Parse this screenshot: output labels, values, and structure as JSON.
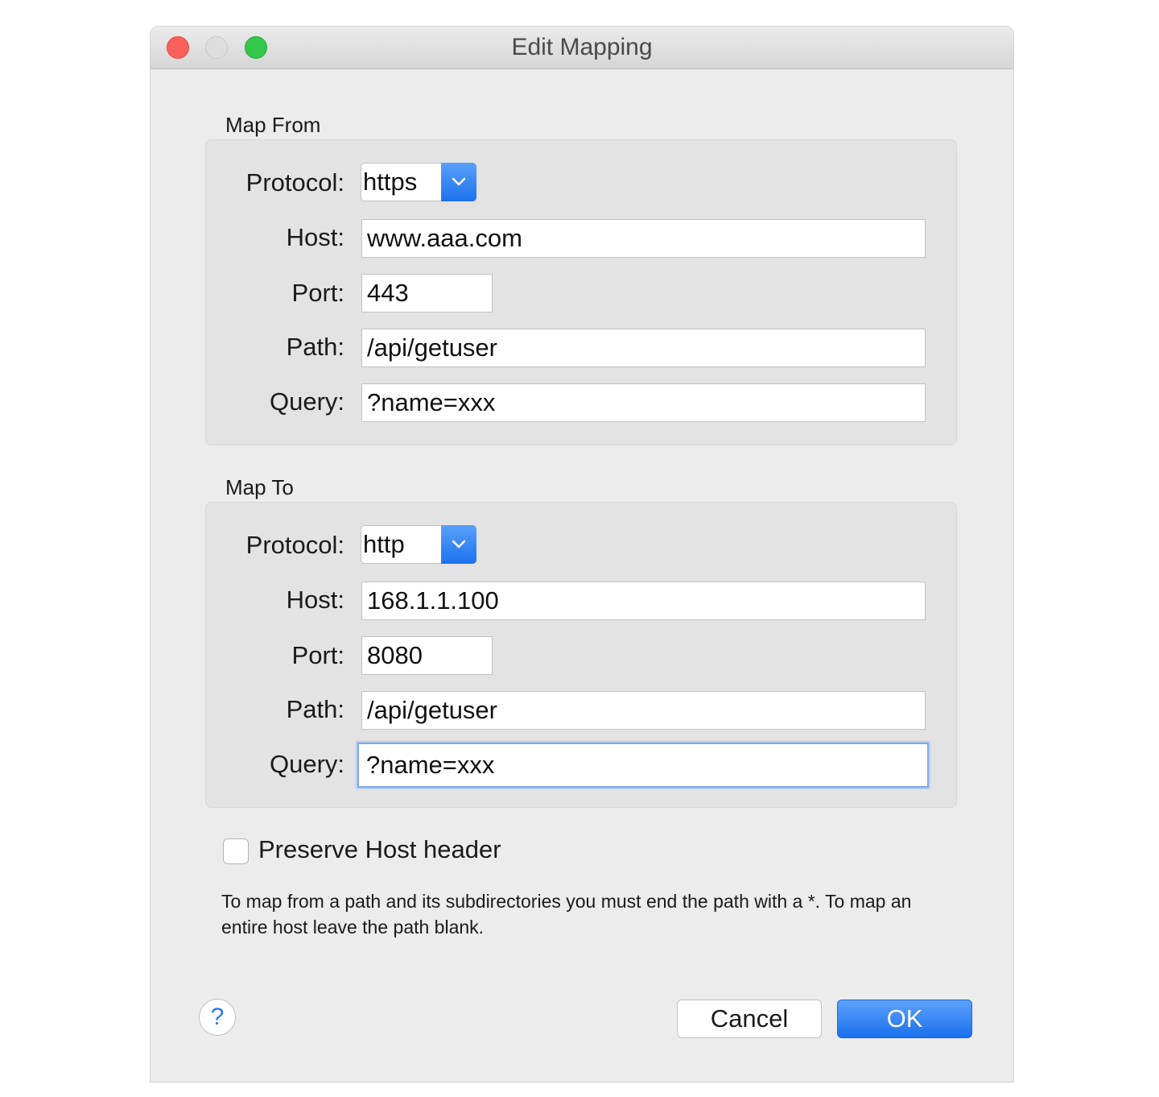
{
  "window": {
    "title": "Edit Mapping"
  },
  "map_from": {
    "label": "Map From",
    "protocol_label": "Protocol:",
    "protocol": "https",
    "host_label": "Host:",
    "host": "www.aaa.com",
    "port_label": "Port:",
    "port": "443",
    "path_label": "Path:",
    "path": "/api/getuser",
    "query_label": "Query:",
    "query": "?name=xxx"
  },
  "map_to": {
    "label": "Map To",
    "protocol_label": "Protocol:",
    "protocol": "http",
    "host_label": "Host:",
    "host": "168.1.1.100",
    "port_label": "Port:",
    "port": "8080",
    "path_label": "Path:",
    "path": "/api/getuser",
    "query_label": "Query:",
    "query": "?name=xxx"
  },
  "options": {
    "preserve_host_label": "Preserve Host header",
    "preserve_host_checked": false
  },
  "hint": "To map from a path and its subdirectories you must end the path with a *. To map an entire host leave the path blank.",
  "buttons": {
    "help": "?",
    "cancel": "Cancel",
    "ok": "OK"
  },
  "icons": {
    "dropdown": "chevron-down-icon",
    "help": "question-icon"
  },
  "colors": {
    "accent": "#1b72ee",
    "focus_ring": "#7fa9e6",
    "close": "#fc605b",
    "maximize": "#34c84a"
  }
}
